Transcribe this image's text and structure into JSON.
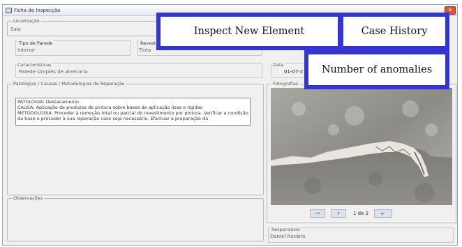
{
  "window": {
    "title": "Ficha de Inspecção"
  },
  "fields": {
    "localizacao": {
      "label": "Localização",
      "value": "Sala"
    },
    "tipo_parede": {
      "label": "Tipo de Parede",
      "value": "Interior"
    },
    "revestimento": {
      "label": "Revest",
      "value": "Tinta"
    },
    "caracteristicas": {
      "label": "Características",
      "value": "Parede simples de alvenaria"
    },
    "data": {
      "label": "Data",
      "value": "01-07-2"
    },
    "patologias": {
      "label": "Patologias / Causas / Metodologias de Reparação",
      "text": "PATOLOGIA: Destacamento\nCAUSA: Aplicação de produtos de pintura sobre bases de aplicação lisas e rígidas\nMETODOLOGIA: Proceder à remoção total ou parcial do revestimento por pintura. Verificar a condição da base e proceder à sua reparação caso seja necessário. Efectuar a preparação da"
    },
    "observacoes": {
      "label": "Observações"
    },
    "fotografias": {
      "label": "Fotografias"
    },
    "responsavel": {
      "label": "Responsável",
      "value": "Daniel Rosário"
    }
  },
  "photo_nav": {
    "count": "1 de 2"
  },
  "callouts": {
    "inspect_new": "Inspect New Element",
    "case_history": "Case History",
    "anomalies": "Number of anomalies"
  },
  "colors": {
    "callout_border": "#3535d0",
    "close_button": "#d9503f"
  }
}
